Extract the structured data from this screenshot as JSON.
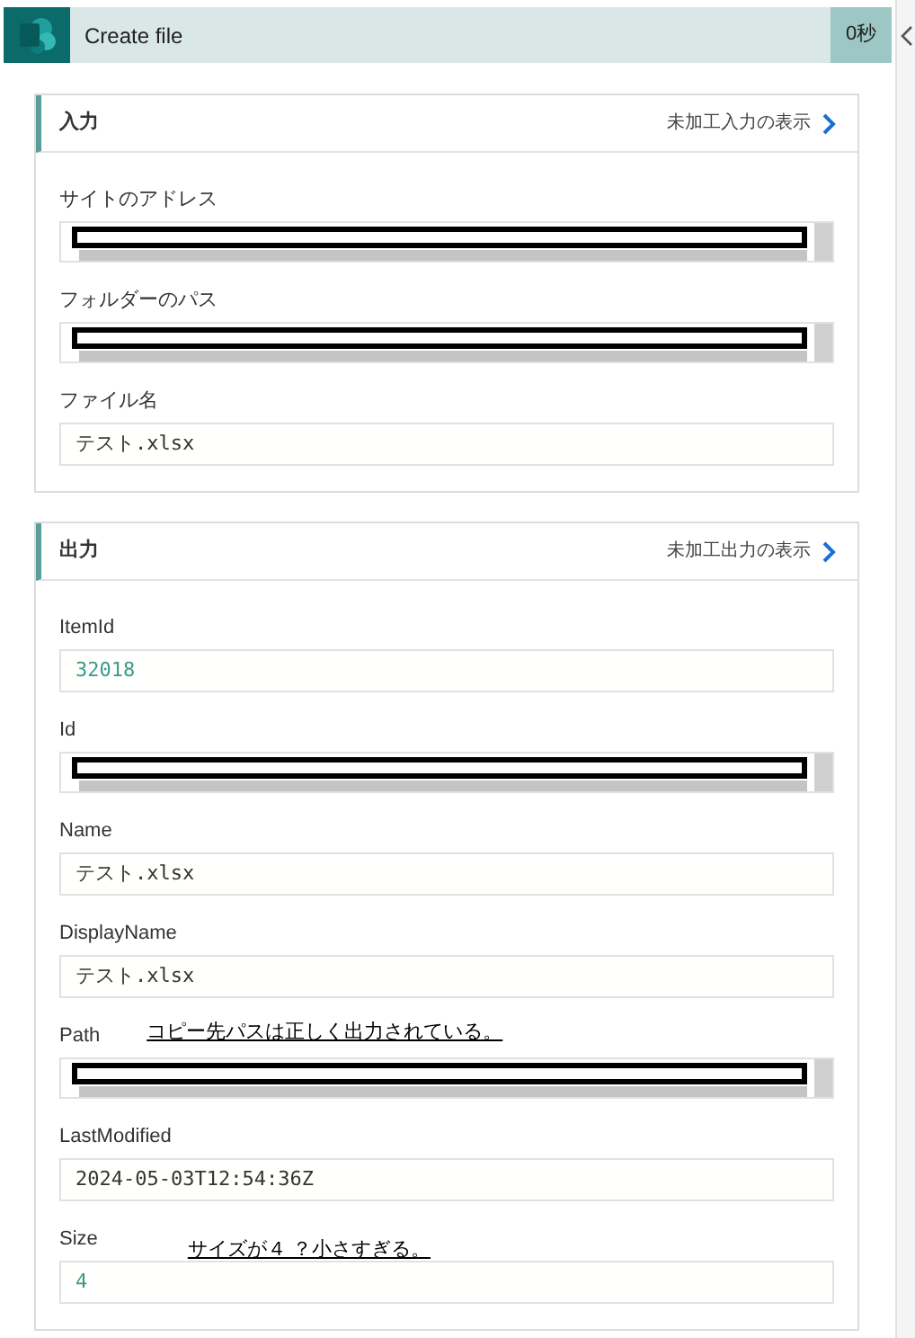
{
  "header": {
    "title": "Create file",
    "duration": "0秒"
  },
  "sections": [
    {
      "title": "入力",
      "link": "未加工入力の表示",
      "fields": [
        {
          "label": "サイトのアドレス",
          "kind": "redacted"
        },
        {
          "label": "フォルダーのパス",
          "kind": "redacted"
        },
        {
          "label": "ファイル名",
          "kind": "text",
          "value": "テスト.xlsx"
        }
      ]
    },
    {
      "title": "出力",
      "link": "未加工出力の表示",
      "fields": [
        {
          "label": "ItemId",
          "kind": "number",
          "value": "32018"
        },
        {
          "label": "Id",
          "kind": "redacted"
        },
        {
          "label": "Name",
          "kind": "text",
          "value": "テスト.xlsx"
        },
        {
          "label": "DisplayName",
          "kind": "text",
          "value": "テスト.xlsx"
        },
        {
          "label": "Path",
          "kind": "redacted",
          "note": "コピー先パスは正しく出力されている。"
        },
        {
          "label": "LastModified",
          "kind": "text",
          "value": "2024-05-03T12:54:36Z"
        },
        {
          "label": "Size",
          "kind": "number",
          "value": "4",
          "note": "サイズが４ ？小さすぎる。"
        }
      ]
    }
  ]
}
